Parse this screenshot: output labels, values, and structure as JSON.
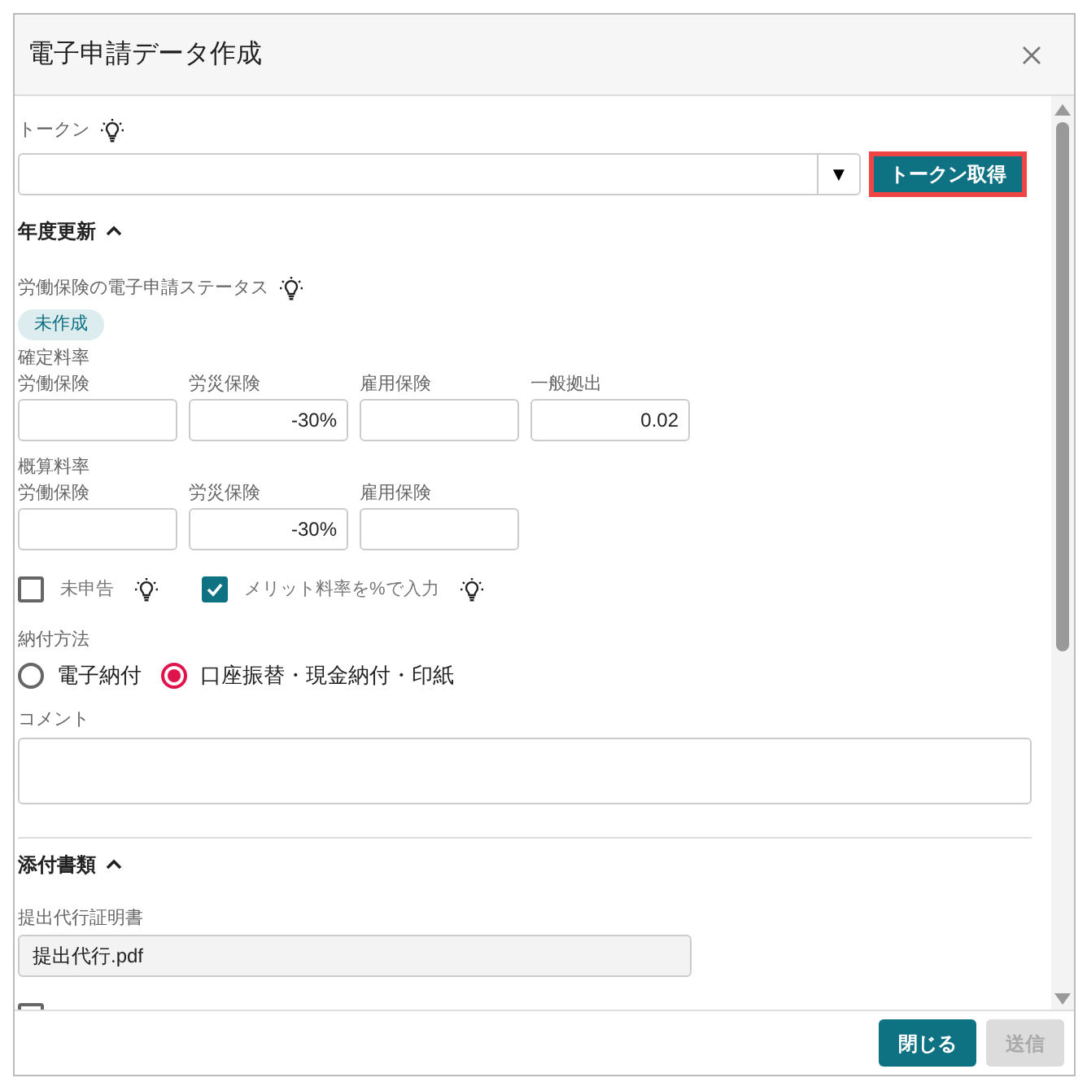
{
  "dialog": {
    "title": "電子申請データ作成"
  },
  "token": {
    "label": "トークン",
    "dropdown_arrow": "▼",
    "button": "トークン取得",
    "highlighted": true
  },
  "annual_update": {
    "title": "年度更新",
    "expanded": true,
    "status_label": "労働保険の電子申請ステータス",
    "status": "未作成",
    "confirmed_rates": {
      "title": "確定料率",
      "fields": [
        {
          "label": "労働保険"
        },
        {
          "label": "労災保険",
          "value": "-30%"
        },
        {
          "label": "雇用保険"
        },
        {
          "label": "一般拠出",
          "value": "0.02"
        }
      ]
    },
    "estimated_rates": {
      "title": "概算料率",
      "fields": [
        {
          "label": "労働保険"
        },
        {
          "label": "労災保険",
          "value": "-30%"
        },
        {
          "label": "雇用保険"
        }
      ]
    },
    "options": [
      {
        "label": "未申告",
        "checked": false
      },
      {
        "label": "メリット料率を%で入力",
        "checked": true
      }
    ],
    "payment": {
      "label": "納付方法",
      "options": [
        {
          "label": "電子納付",
          "selected": false
        },
        {
          "label": "口座振替・現金納付・印紙",
          "selected": true
        }
      ]
    },
    "comment": {
      "label": "コメント"
    }
  },
  "attachments": {
    "title": "添付書類",
    "expanded": true,
    "certificate": {
      "label": "提出代行証明書",
      "value": "提出代行.pdf"
    },
    "pdf_option": {
      "checked": false
    }
  },
  "footer": {
    "buttons": [
      {
        "label": "閉じる",
        "disabled": false
      },
      {
        "label": "送信",
        "disabled": true
      }
    ]
  }
}
